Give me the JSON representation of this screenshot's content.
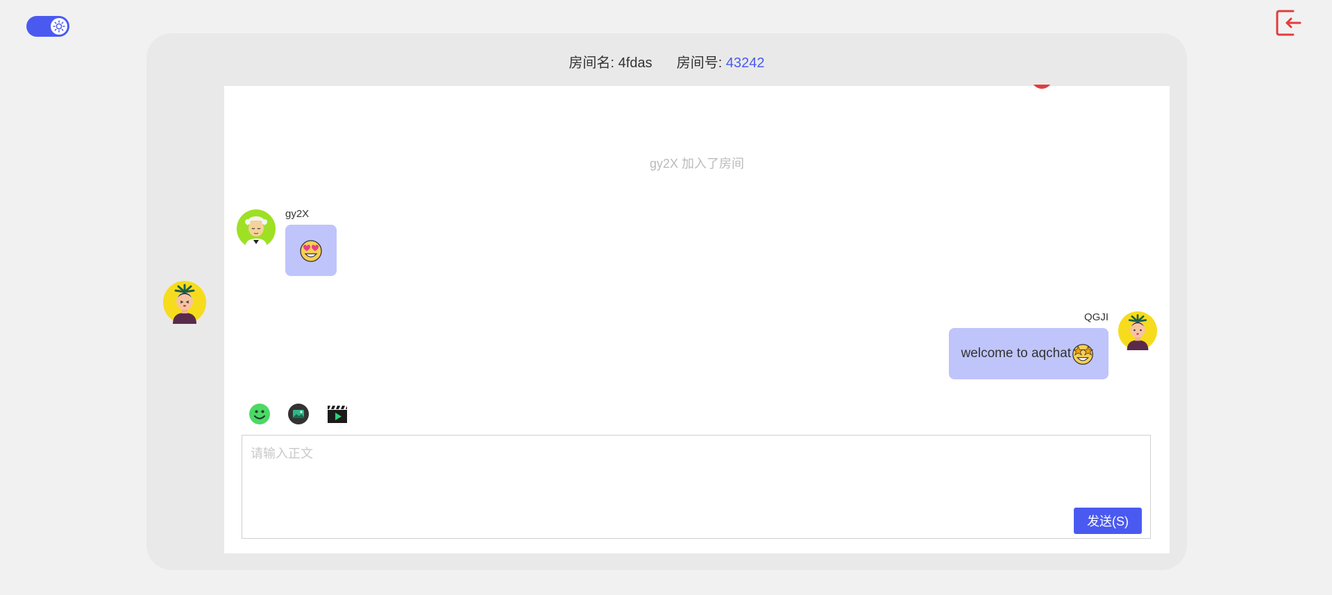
{
  "room": {
    "name_label": "房间名:",
    "name_value": "4fdas",
    "id_label": "房间号:",
    "id_value": "43242"
  },
  "theme_toggle": {
    "icon": "sun-icon",
    "state": "on"
  },
  "exit": {
    "icon": "exit-icon"
  },
  "messages": {
    "system": "gy2X 加入了房间",
    "left": {
      "user": "gy2X",
      "content_icon": "heart-eyes-emoji-icon"
    },
    "right": {
      "user": "QGJI",
      "text": "welcome to aqchat",
      "content_icon": "star-struck-emoji-icon"
    }
  },
  "toolbar": {
    "tools": [
      "emoji-icon",
      "image-icon",
      "video-icon"
    ]
  },
  "editor": {
    "placeholder": "请输入正文",
    "value": "",
    "send_label": "发送(S)"
  },
  "colors": {
    "accent": "#4a5af0",
    "bubble": "#bfc4fb",
    "exit_red": "#e23d3d",
    "background": "#f1f1f1",
    "panel": "#e9e9e9"
  }
}
